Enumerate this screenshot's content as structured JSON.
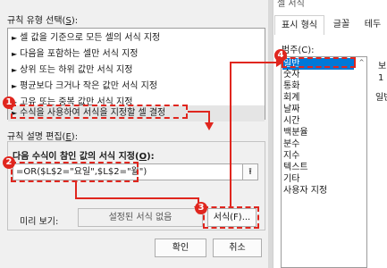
{
  "left_panel": {
    "rule_type_heading": "규칙 유형 선택(",
    "rule_type_key": "S",
    "rule_type_tail": "):",
    "rules": [
      "셀 값을 기준으로 모든 셀의 서식 지정",
      "다음을 포함하는 셀만 서식 지정",
      "상위 또는 하위 값만 서식 지정",
      "평균보다 크거나 작은 값만 서식 지정",
      "고유 또는 중복 값만 서식 지정",
      "수식을 사용하여 서식을 지정할 셀 결정"
    ],
    "edit_heading": "규칙 설명 편집(",
    "edit_key": "E",
    "edit_tail": "):",
    "formula_label": "다음 수식이 참인 값의 서식 지정(",
    "formula_key": "O",
    "formula_tail": "):",
    "formula_value": "=OR($L$2=\"요일\",$L$2=\"월\")",
    "preview_label": "미리 보기:",
    "preview_text": "설정된 서식 없음",
    "format_button": "서식(F)...",
    "ok_button": "확인",
    "cancel_button": "취소"
  },
  "right_panel": {
    "header_partial": "셀 서식",
    "tabs": [
      "표시 형식",
      "글꼴",
      "테두"
    ],
    "category_label": "범주(C):",
    "categories": [
      "일반",
      "숫자",
      "통화",
      "회계",
      "날짜",
      "시간",
      "백분율",
      "분수",
      "지수",
      "텍스트",
      "기타",
      "사용자 지정"
    ],
    "side_text_1": "보",
    "side_text_2": "1",
    "side_text_3": "일반"
  },
  "badges": [
    "1",
    "2",
    "3",
    "4"
  ],
  "colors": {
    "annotation": "#e0261e",
    "selection": "#0078d7"
  }
}
